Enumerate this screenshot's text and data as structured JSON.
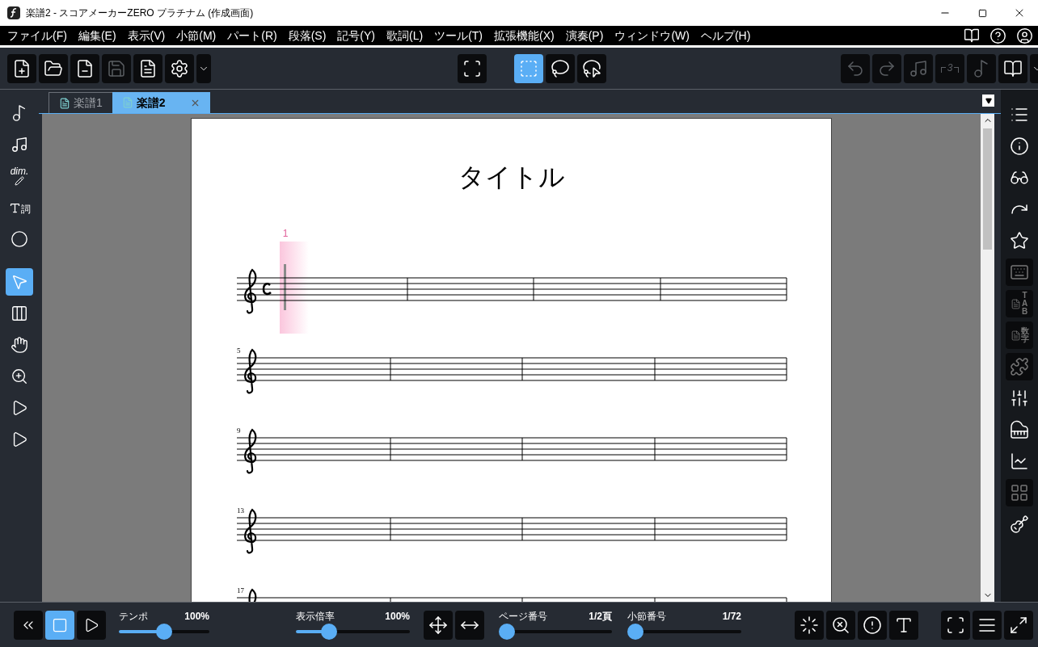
{
  "window": {
    "title": "楽譜2 - スコアメーカーZERO プラチナム (作成画面)"
  },
  "menu": [
    "ファイル(F)",
    "編集(E)",
    "表示(V)",
    "小節(M)",
    "パート(R)",
    "段落(S)",
    "記号(Y)",
    "歌詞(L)",
    "ツール(T)",
    "拡張機能(X)",
    "演奏(P)",
    "ウィンドウ(W)",
    "ヘルプ(H)"
  ],
  "toolbar": {
    "file_tools": [
      {
        "disabled": false
      },
      {
        "disabled": false
      },
      {
        "disabled": false
      },
      {
        "disabled": true
      },
      {
        "disabled": false
      },
      {
        "disabled": false
      }
    ],
    "select_tools": [
      {
        "selected": true
      },
      {
        "selected": false
      },
      {
        "selected": false
      }
    ],
    "edit_tools": [
      {
        "disabled": true
      },
      {
        "disabled": true
      },
      {
        "disabled": true
      },
      {
        "disabled": true,
        "label": "3"
      },
      {
        "disabled": true
      },
      {
        "disabled": false
      }
    ]
  },
  "tabs": [
    {
      "label": "楽譜1",
      "selected": false,
      "closable": false
    },
    {
      "label": "楽譜2",
      "selected": true,
      "closable": true
    }
  ],
  "left_tools": [
    {
      "selected": false
    },
    {
      "selected": false
    },
    {
      "selected": false,
      "label": "dim."
    },
    {
      "selected": false,
      "label": "詞"
    },
    {
      "selected": false
    },
    {
      "selected": true
    },
    {
      "selected": false
    },
    {
      "selected": false
    },
    {
      "selected": false
    },
    {
      "selected": false
    },
    {
      "selected": false
    }
  ],
  "right_tools": [
    {
      "disabled": false
    },
    {
      "disabled": false
    },
    {
      "disabled": false
    },
    {
      "disabled": false
    },
    {
      "disabled": false
    },
    {
      "disabled": true
    },
    {
      "disabled": true,
      "label": "TAB"
    },
    {
      "disabled": true,
      "label": "数字"
    },
    {
      "disabled": true
    },
    {
      "disabled": false
    },
    {
      "disabled": false
    },
    {
      "disabled": false
    },
    {
      "disabled": true
    },
    {
      "disabled": false
    }
  ],
  "score": {
    "title": "タイトル",
    "systems": [
      {
        "time_signature": true,
        "cursor_label": "1"
      },
      {
        "time_signature": false,
        "measure_number": "5"
      },
      {
        "time_signature": false,
        "measure_number": "9"
      },
      {
        "time_signature": false,
        "measure_number": "13"
      },
      {
        "time_signature": false,
        "measure_number": "17"
      }
    ]
  },
  "transport": [
    {
      "selected": false
    },
    {
      "selected": true
    },
    {
      "selected": false
    }
  ],
  "sliders": [
    {
      "label": "テンポ",
      "reading": "100%",
      "level": 0.5
    },
    {
      "label": "表示倍率",
      "reading": "100%",
      "level": 0.26
    },
    {
      "label": "ページ番号",
      "reading": "1/2頁",
      "level": 0
    },
    {
      "label": "小節番号",
      "reading": "1/72",
      "level": 0
    }
  ]
}
